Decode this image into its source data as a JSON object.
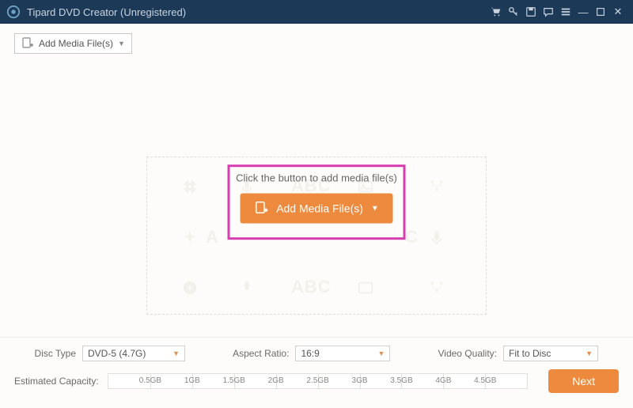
{
  "titlebar": {
    "app_title": "Tipard DVD Creator (Unregistered)"
  },
  "toolbar": {
    "add_media_label": "Add Media File(s)"
  },
  "main": {
    "cta_text": "Click the button to add media file(s)",
    "cta_button": "Add Media File(s)",
    "watermark_abc": "ABC"
  },
  "footer": {
    "disc_type_label": "Disc Type",
    "disc_type_value": "DVD-5 (4.7G)",
    "aspect_ratio_label": "Aspect Ratio:",
    "aspect_ratio_value": "16:9",
    "video_quality_label": "Video Quality:",
    "video_quality_value": "Fit to Disc",
    "est_cap_label": "Estimated Capacity:",
    "ticks": [
      "0.5GB",
      "1GB",
      "1.5GB",
      "2GB",
      "2.5GB",
      "3GB",
      "3.5GB",
      "4GB",
      "4.5GB"
    ],
    "next_label": "Next"
  }
}
